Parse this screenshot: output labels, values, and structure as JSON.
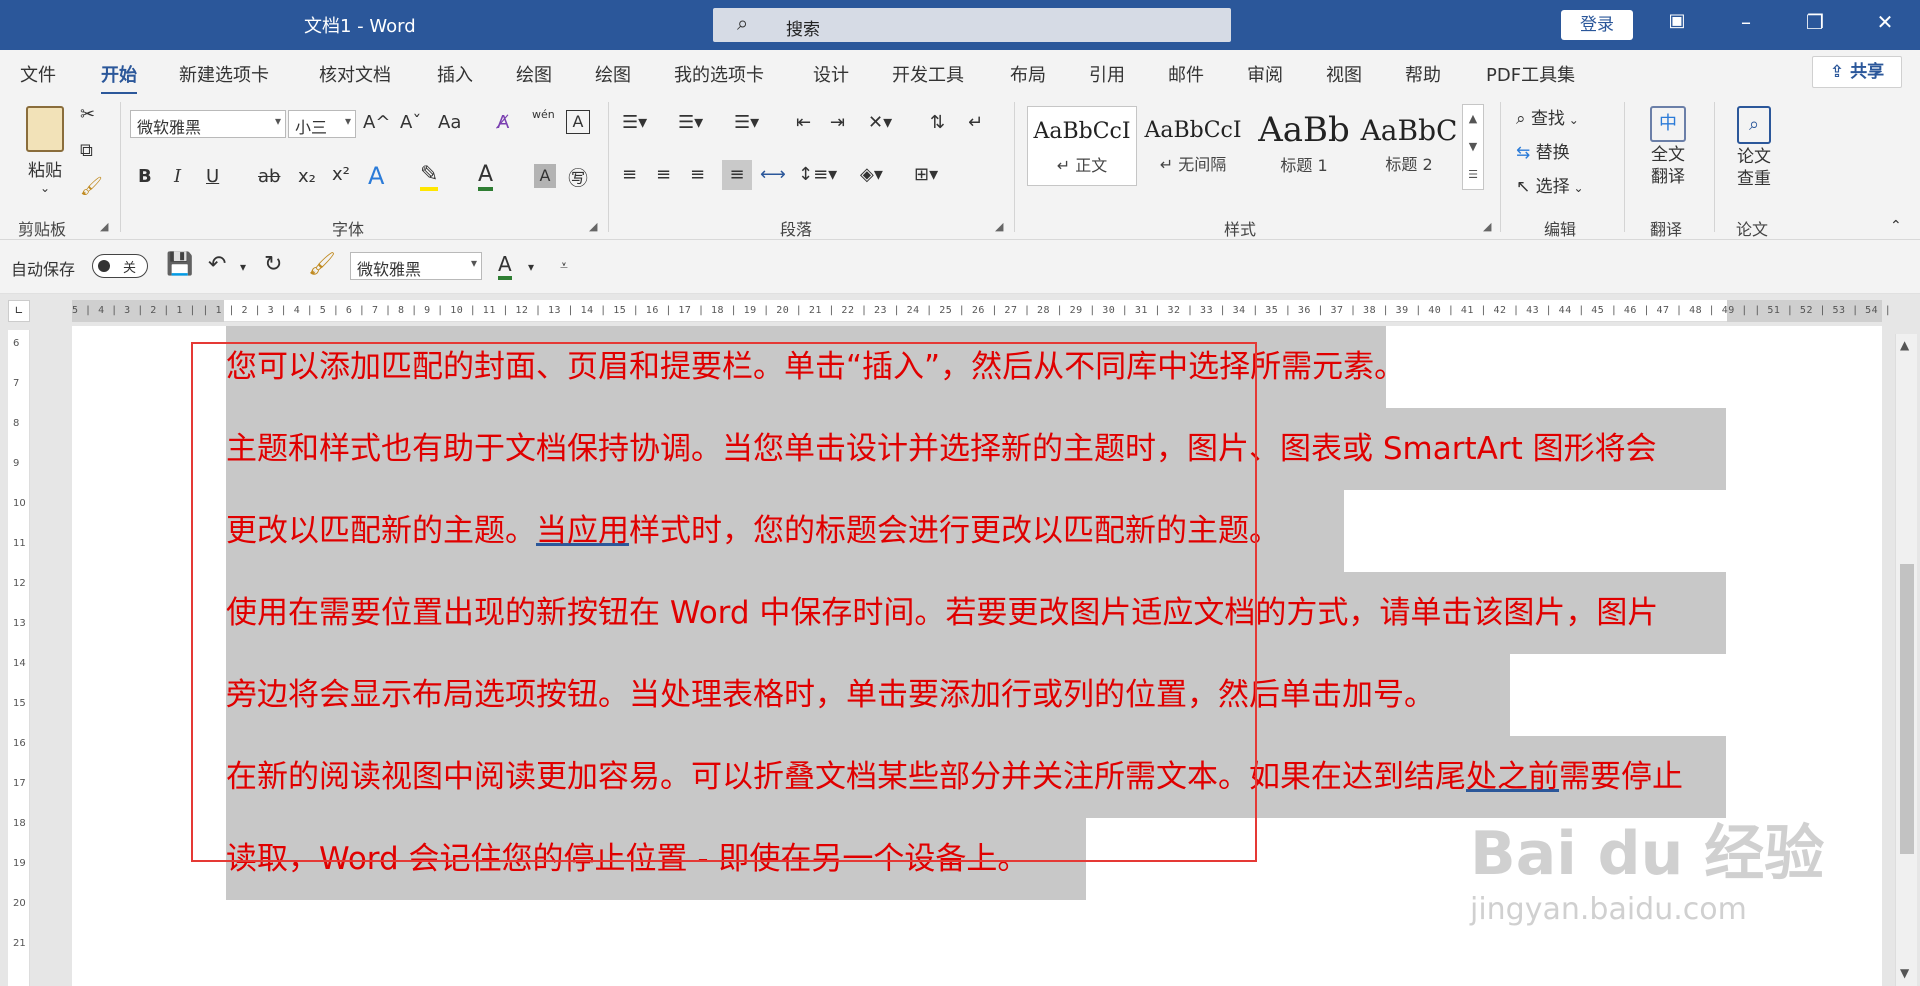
{
  "titlebar": {
    "title": "文档1 - Word",
    "search_placeholder": "搜索",
    "login_label": "登录",
    "ribbon_display_icon": "ribbon-display-icon",
    "minimize_symbol": "–",
    "restore_symbol": "❐",
    "close_symbol": "✕"
  },
  "menu": {
    "tabs": [
      "文件",
      "开始",
      "新建选项卡",
      "核对文档",
      "插入",
      "绘图",
      "绘图",
      "我的选项卡",
      "设计",
      "开发工具",
      "布局",
      "引用",
      "邮件",
      "审阅",
      "视图",
      "帮助",
      "PDF工具集"
    ],
    "active_tab": "开始",
    "share_label": "共享"
  },
  "ribbon": {
    "clipboard": {
      "paste_label": "粘贴",
      "group_label": "剪贴板"
    },
    "font": {
      "font_name": "微软雅黑",
      "font_size": "小三",
      "group_label": "字体",
      "grow_label": "A^",
      "shrink_label": "Aˇ",
      "case_label": "Aa",
      "phonetic_label": "wén",
      "bold": "B",
      "italic": "I",
      "underline": "U",
      "strike": "ab",
      "subscript": "x₂",
      "superscript": "x²"
    },
    "paragraph": {
      "group_label": "段落"
    },
    "styles": {
      "group_label": "样式",
      "items": [
        {
          "sample": "AaBbCcI",
          "name": "↵ 正文"
        },
        {
          "sample": "AaBbCcI",
          "name": "↵ 无间隔"
        },
        {
          "sample": "AaBb",
          "name": "标题 1"
        },
        {
          "sample": "AaBbC",
          "name": "标题 2"
        }
      ]
    },
    "editing": {
      "find": "查找",
      "replace": "替换",
      "select": "选择",
      "group_label": "编辑"
    },
    "translate": {
      "label": "全文\n翻译",
      "group_label": "翻译"
    },
    "paper": {
      "label": "论文\n查重",
      "group_label": "论文"
    }
  },
  "qat": {
    "autosave_label": "自动保存",
    "autosave_state": "关",
    "font_name": "微软雅黑"
  },
  "ruler": {
    "numbers": "5 | 4 | 3 | 2 | 1 |    | 1 | 2 | 3 | 4 | 5 | 6 | 7 | 8 | 9 | 10 | 11 | 12 | 13 | 14 | 15 | 16 | 17 | 18 | 19 | 20 | 21 | 22 | 23 | 24 | 25 | 26 | 27 | 28 | 29 | 30 | 31 | 32 | 33 | 34 | 35 | 36 | 37 | 38 | 39 | 40 | 41 | 42 | 43 | 44 | 45 | 46 | 47 | 48 | 49 |    | 51 | 52 | 53 | 54 |",
    "vertical": [
      "6",
      "7",
      "8",
      "9",
      "10",
      "11",
      "12",
      "13",
      "14",
      "15",
      "16",
      "17",
      "18",
      "19",
      "20",
      "21"
    ]
  },
  "document": {
    "lines": [
      {
        "pre": "您可以添加匹配的封面、页眉和提要栏。单击“插入”，然后从不同库中选择所需元素。",
        "u": "",
        "post": ""
      },
      {
        "pre": "主题和样式也有助于文档保持协调。当您单击设计并选择新的主题时，图片、图表或 SmartArt 图形将会",
        "u": "",
        "post": ""
      },
      {
        "pre": "更改以匹配新的主题。",
        "u": "当应用",
        "post": "样式时，您的标题会进行更改以匹配新的主题。"
      },
      {
        "pre": "使用在需要位置出现的新按钮在 Word 中保存时间。若要更改图片适应文档的方式，请单击该图片，图片",
        "u": "",
        "post": ""
      },
      {
        "pre": "旁边将会显示布局选项按钮。当处理表格时，单击要添加行或列的位置，然后单击加号。",
        "u": "",
        "post": ""
      },
      {
        "pre": "在新的阅读视图中阅读更加容易。可以折叠文档某些部分并关注所需文本。如果在达到结尾",
        "u": "处之前",
        "post": "需要停止"
      },
      {
        "pre": "读取，Word 会记住您的停止位置 - 即使在另一个设备上。",
        "u": "",
        "post": ""
      }
    ],
    "text_color": "#e00000",
    "highlight_color": "#c8c8c8"
  },
  "watermark": {
    "brand": "Bai du 经验",
    "url": "jingyan.baidu.com"
  },
  "colors": {
    "brand": "#2b579a",
    "annotation": "#e53935"
  }
}
